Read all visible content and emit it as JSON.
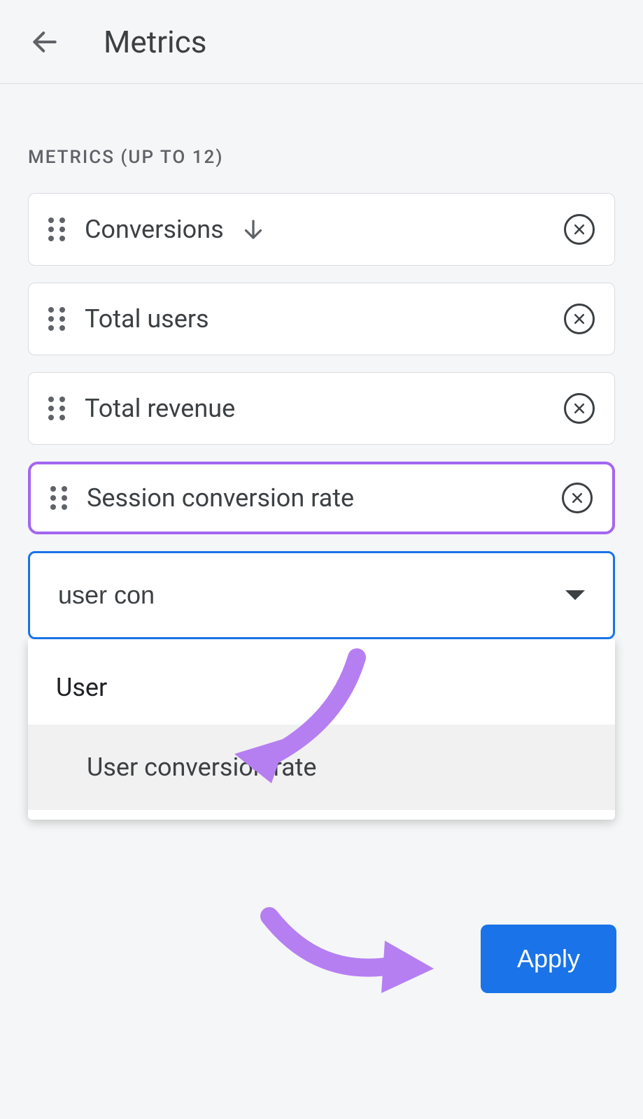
{
  "header": {
    "title": "Metrics"
  },
  "section_label": "METRICS (UP TO 12)",
  "metrics": [
    {
      "label": "Conversions",
      "sorted": true
    },
    {
      "label": "Total users",
      "sorted": false
    },
    {
      "label": "Total revenue",
      "sorted": false
    },
    {
      "label": "Session conversion rate",
      "sorted": false,
      "highlighted": true
    }
  ],
  "search": {
    "value": "user con"
  },
  "dropdown": {
    "group": "User",
    "option": "User conversion rate"
  },
  "apply_label": "Apply"
}
